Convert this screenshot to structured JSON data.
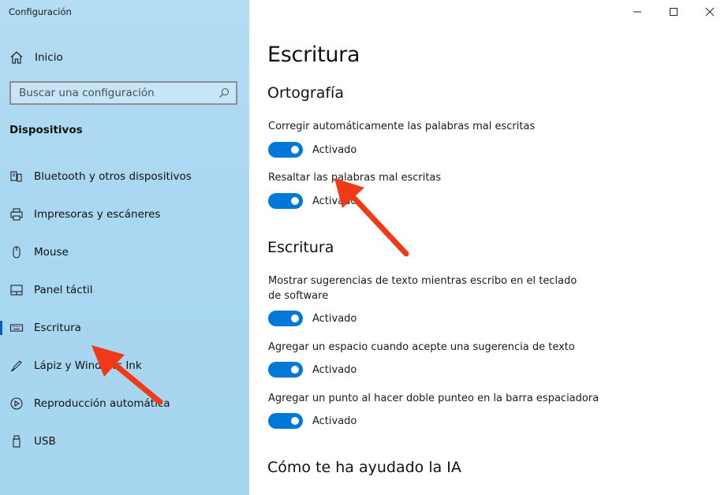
{
  "window": {
    "title": "Configuración"
  },
  "sidebar": {
    "home_label": "Inicio",
    "search_placeholder": "Buscar una configuración",
    "section_title": "Dispositivos",
    "items": [
      {
        "label": "Bluetooth y otros dispositivos",
        "icon": "bluetooth-devices-icon"
      },
      {
        "label": "Impresoras y escáneres",
        "icon": "printer-icon"
      },
      {
        "label": "Mouse",
        "icon": "mouse-icon"
      },
      {
        "label": "Panel táctil",
        "icon": "touchpad-icon"
      },
      {
        "label": "Escritura",
        "icon": "keyboard-icon",
        "selected": true
      },
      {
        "label": "Lápiz y Windows Ink",
        "icon": "pen-icon"
      },
      {
        "label": "Reproducción automática",
        "icon": "autoplay-icon"
      },
      {
        "label": "USB",
        "icon": "usb-icon"
      }
    ]
  },
  "main": {
    "title": "Escritura",
    "sections": [
      {
        "heading": "Ortografía",
        "settings": [
          {
            "label": "Corregir automáticamente las palabras mal escritas",
            "state": "Activado",
            "on": true
          },
          {
            "label": "Resaltar las palabras mal escritas",
            "state": "Activado",
            "on": true
          }
        ]
      },
      {
        "heading": "Escritura",
        "settings": [
          {
            "label": "Mostrar sugerencias de texto mientras escribo en el teclado de software",
            "state": "Activado",
            "on": true
          },
          {
            "label": "Agregar un espacio cuando acepte una sugerencia de texto",
            "state": "Activado",
            "on": true
          },
          {
            "label": "Agregar un punto al hacer doble punteo en la barra espaciadora",
            "state": "Activado",
            "on": true
          }
        ]
      },
      {
        "heading": "Cómo te ha ayudado la IA"
      }
    ]
  },
  "colors": {
    "accent": "#0078d7",
    "sidebar": "#aad7f1",
    "annotation_arrow": "#f03a17"
  }
}
